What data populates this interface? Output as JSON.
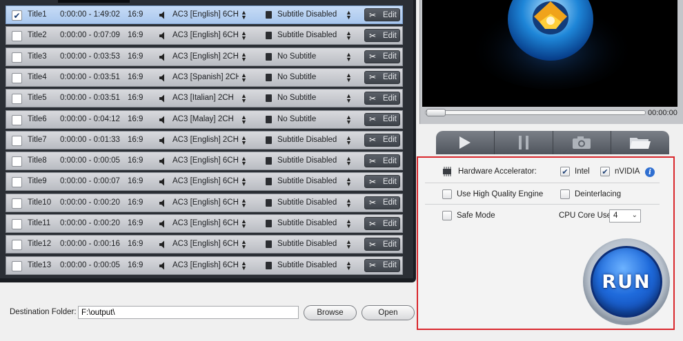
{
  "titles": [
    {
      "name": "Title1",
      "duration": "0:00:00 - 1:49:02",
      "ratio": "16:9",
      "audio": "AC3 [English] 6CH",
      "subtitle": "Subtitle Disabled",
      "checked": true,
      "selected": true
    },
    {
      "name": "Title2",
      "duration": "0:00:00 - 0:07:09",
      "ratio": "16:9",
      "audio": "AC3 [English] 6CH",
      "subtitle": "Subtitle Disabled",
      "checked": false
    },
    {
      "name": "Title3",
      "duration": "0:00:00 - 0:03:53",
      "ratio": "16:9",
      "audio": "AC3 [English] 2CH",
      "subtitle": "No Subtitle",
      "checked": false
    },
    {
      "name": "Title4",
      "duration": "0:00:00 - 0:03:51",
      "ratio": "16:9",
      "audio": "AC3 [Spanish] 2CH",
      "subtitle": "No Subtitle",
      "checked": false
    },
    {
      "name": "Title5",
      "duration": "0:00:00 - 0:03:51",
      "ratio": "16:9",
      "audio": "AC3 [Italian] 2CH",
      "subtitle": "No Subtitle",
      "checked": false
    },
    {
      "name": "Title6",
      "duration": "0:00:00 - 0:04:12",
      "ratio": "16:9",
      "audio": "AC3 [Malay] 2CH",
      "subtitle": "No Subtitle",
      "checked": false
    },
    {
      "name": "Title7",
      "duration": "0:00:00 - 0:01:33",
      "ratio": "16:9",
      "audio": "AC3 [English] 2CH",
      "subtitle": "Subtitle Disabled",
      "checked": false
    },
    {
      "name": "Title8",
      "duration": "0:00:00 - 0:00:05",
      "ratio": "16:9",
      "audio": "AC3 [English] 6CH",
      "subtitle": "Subtitle Disabled",
      "checked": false
    },
    {
      "name": "Title9",
      "duration": "0:00:00 - 0:00:07",
      "ratio": "16:9",
      "audio": "AC3 [English] 6CH",
      "subtitle": "Subtitle Disabled",
      "checked": false
    },
    {
      "name": "Title10",
      "duration": "0:00:00 - 0:00:20",
      "ratio": "16:9",
      "audio": "AC3 [English] 6CH",
      "subtitle": "Subtitle Disabled",
      "checked": false
    },
    {
      "name": "Title11",
      "duration": "0:00:00 - 0:00:20",
      "ratio": "16:9",
      "audio": "AC3 [English] 6CH",
      "subtitle": "Subtitle Disabled",
      "checked": false
    },
    {
      "name": "Title12",
      "duration": "0:00:00 - 0:00:16",
      "ratio": "16:9",
      "audio": "AC3 [English] 6CH",
      "subtitle": "Subtitle Disabled",
      "checked": false
    },
    {
      "name": "Title13",
      "duration": "0:00:00 - 0:00:05",
      "ratio": "16:9",
      "audio": "AC3 [English] 6CH",
      "subtitle": "Subtitle Disabled",
      "checked": false
    }
  ],
  "edit_label": "Edit",
  "destination": {
    "label": "Destination Folder:",
    "value": "F:\\output\\",
    "browse_label": "Browse",
    "open_label": "Open"
  },
  "preview": {
    "time": "00:00:00",
    "progress": 0.0,
    "controls": [
      "play-icon",
      "pause-icon",
      "camera-icon",
      "folder-icon"
    ]
  },
  "options": {
    "hw_label": "Hardware Accelerator:",
    "intel_label": "Intel",
    "intel_checked": true,
    "nvidia_label": "nVIDIA",
    "nvidia_checked": true,
    "hq_label": "Use High Quality Engine",
    "hq_checked": false,
    "deint_label": "Deinterlacing",
    "deint_checked": false,
    "safe_label": "Safe Mode",
    "safe_checked": false,
    "cpu_label": "CPU Core Use:",
    "cpu_value": "4"
  },
  "run_label": "RUN",
  "colors": {
    "highlight_border": "#d9262b",
    "run_blue": "#1f6bdc",
    "list_bg": "#2b2f35",
    "selected_row": "#a9c7ee"
  }
}
